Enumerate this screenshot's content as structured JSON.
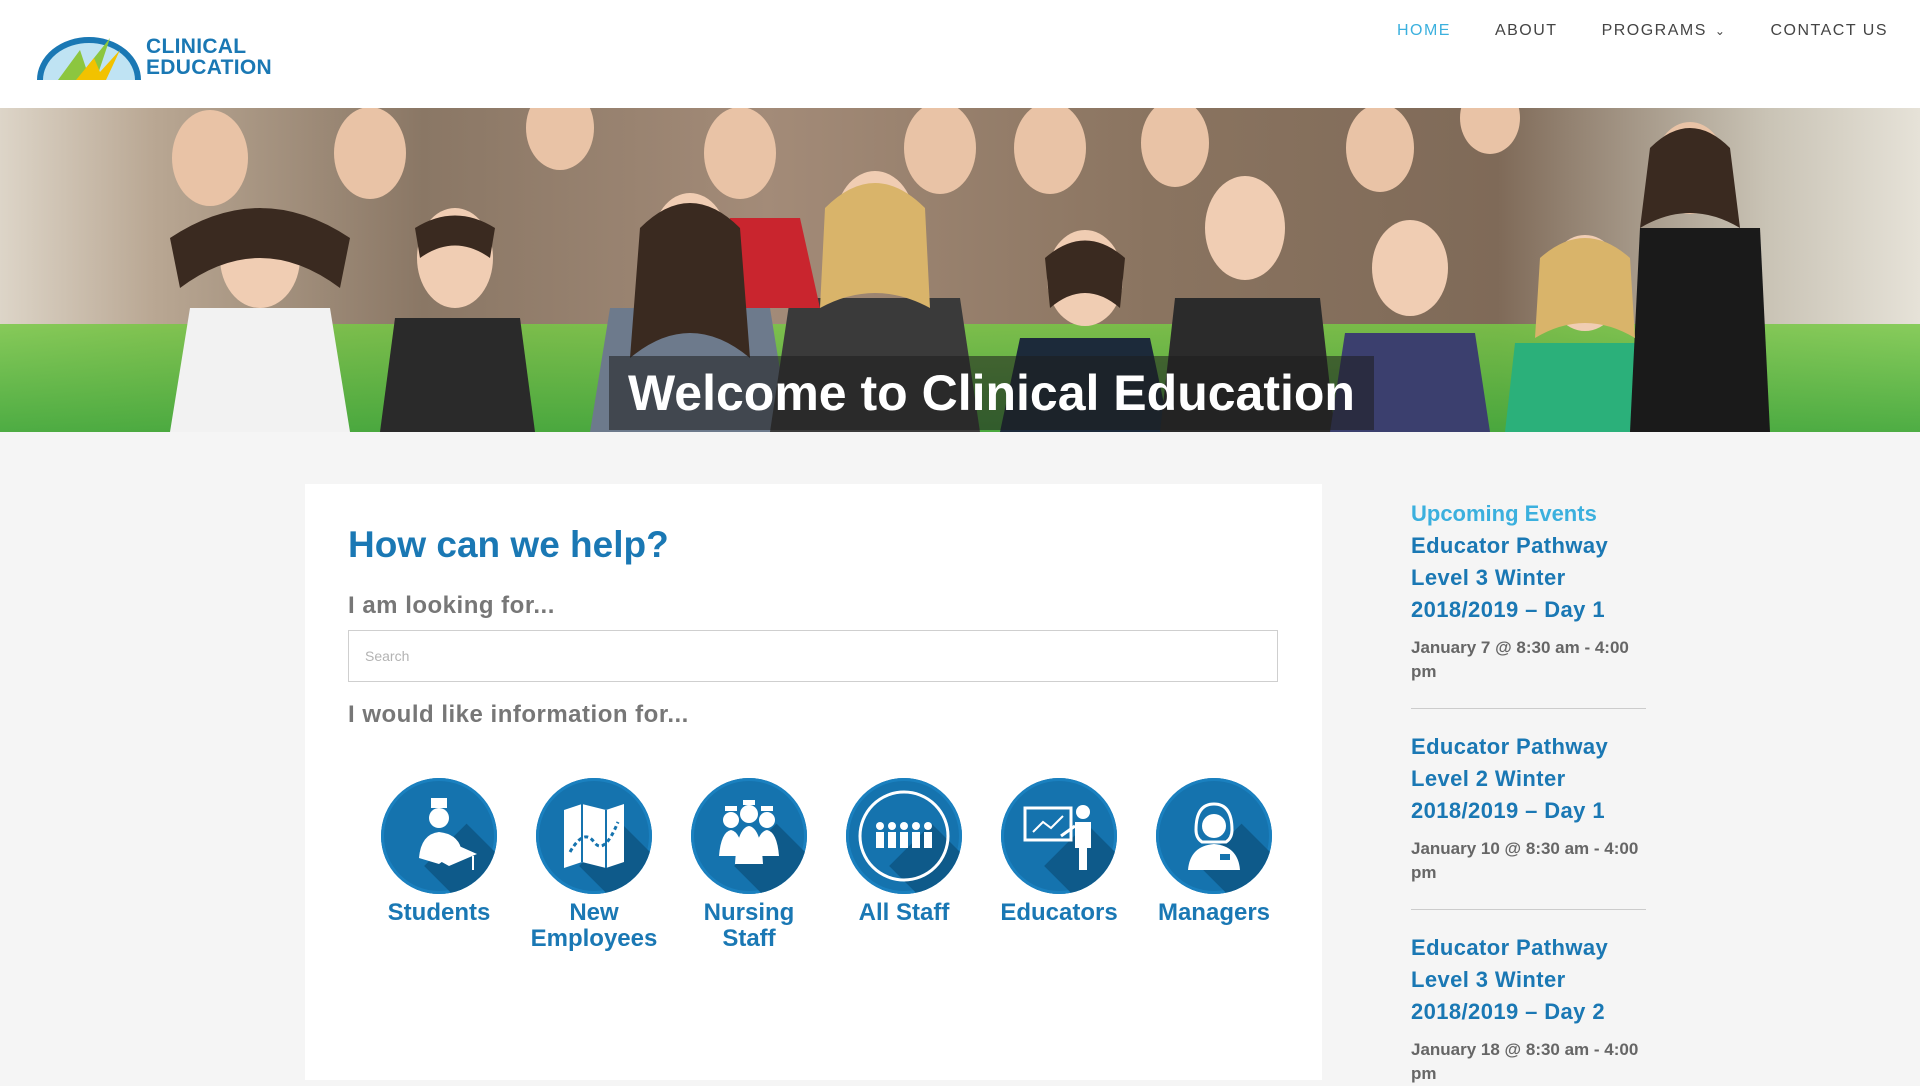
{
  "brand": {
    "line1": "CLINICAL",
    "line2": "EDUCATION",
    "color": "#1a78b4",
    "accent": "#3bb0de"
  },
  "nav": {
    "items": [
      {
        "label": "HOME",
        "active": true
      },
      {
        "label": "ABOUT",
        "active": false
      },
      {
        "label": "PROGRAMS",
        "active": false
      },
      {
        "label": "CONTACT US",
        "active": false
      }
    ]
  },
  "hero": {
    "title": "Welcome to Clinical Education"
  },
  "help": {
    "title": "How can we help?",
    "looking_label": "I am looking for...",
    "search_placeholder": "Search",
    "info_label": "I would like information for..."
  },
  "categories": [
    {
      "label": "Students",
      "icon": "student-graduate-icon"
    },
    {
      "label": "New Employees",
      "icon": "map-icon"
    },
    {
      "label": "Nursing Staff",
      "icon": "nurses-group-icon"
    },
    {
      "label": "All Staff",
      "icon": "staff-group-icon"
    },
    {
      "label": "Educators",
      "icon": "presenter-board-icon"
    },
    {
      "label": "Managers",
      "icon": "manager-icon"
    }
  ],
  "sidebar": {
    "title": "Upcoming Events",
    "events": [
      {
        "title": "Educator Pathway Level 3 Winter 2018/2019 – Day 1",
        "date": "January 7 @ 8:30 am - 4:00 pm"
      },
      {
        "title": "Educator Pathway Level 2 Winter 2018/2019 – Day 1",
        "date": "January 10 @ 8:30 am - 4:00 pm"
      },
      {
        "title": "Educator Pathway Level 3 Winter 2018/2019 – Day 2",
        "date": "January 18 @ 8:30 am - 4:00 pm"
      }
    ]
  }
}
